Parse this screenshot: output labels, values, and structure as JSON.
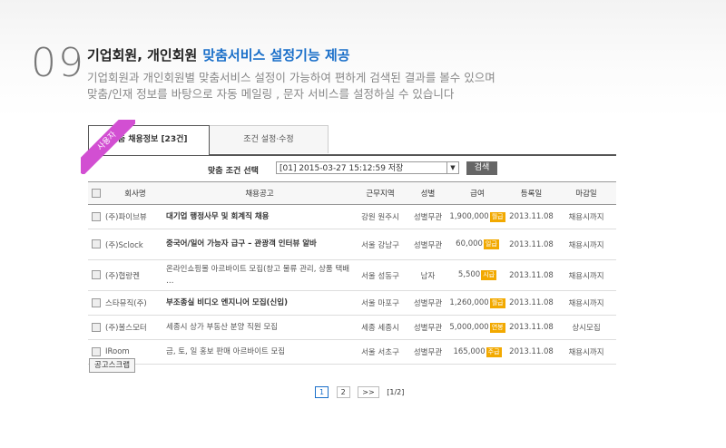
{
  "header": {
    "number": "09",
    "title": "기업회원, 개인회원",
    "title_highlight": "맞춤서비스 설정기능 제공",
    "desc1": "기업회원과 개인회원별 맞춤서비스 설정이 가능하여 편하게 검색된 결과를 볼수 있으며",
    "desc2": "맞춤/인재 정보를 바탕으로 자동 메일링 , 문자 서비스를 설정하실 수 있습니다"
  },
  "ribbon": "사용자",
  "tabs": {
    "active": "맞춤 채용정보 [23건]",
    "other": "조건 설정·수정"
  },
  "search": {
    "label": "맞춤 조건 선택",
    "selected": "[01] 2015-03-27 15:12:59 저장",
    "button": "검색"
  },
  "table": {
    "headers": [
      "회사명",
      "채용공고",
      "근무지역",
      "성별",
      "급여",
      "등록일",
      "마감일"
    ],
    "rows": [
      {
        "company": "(주)파이브뷰",
        "title": "대기업 행정사무 및 회계직 채용",
        "bold": true,
        "area": "강원 원주시",
        "gender": "성별무관",
        "pay": "1,900,000",
        "unit": "월급",
        "date": "2013.11.08",
        "close": "채용시까지"
      },
      {
        "company": "(주)Sclock",
        "title": "중국어/일어 가능자 급구 – 관광객 인터뷰 알바",
        "bold": true,
        "area": "서울 강남구",
        "gender": "성별무관",
        "pay": "60,000",
        "unit": "일급",
        "date": "2013.11.08",
        "close": "채용시까지"
      },
      {
        "company": "(주)협랑켄",
        "title": "온라인쇼핑몰 아르바이트 모집(창고 물류 관리, 상품 택배 …",
        "bold": false,
        "area": "서울 성동구",
        "gender": "남자",
        "pay": "5,500",
        "unit": "시급",
        "date": "2013.11.08",
        "close": "채용시까지"
      },
      {
        "company": "스타뮤직(주)",
        "title": "부조종실 비디오 엔지니어 모집(신입)",
        "bold": true,
        "area": "서울 마포구",
        "gender": "성별무관",
        "pay": "1,260,000",
        "unit": "월급",
        "date": "2013.11.08",
        "close": "채용시까지"
      },
      {
        "company": "(주)볼스모터",
        "title": "세종시 상가 부동산 분양 직원 모집",
        "bold": false,
        "area": "세종 세종시",
        "gender": "성별무관",
        "pay": "5,000,000",
        "unit": "연봉",
        "date": "2013.11.08",
        "close": "상시모집"
      },
      {
        "company": "IRoom",
        "title": "금, 토, 일 홍보 판매 아르바이트 모집",
        "bold": false,
        "area": "서울 서초구",
        "gender": "성별무관",
        "pay": "165,000",
        "unit": "주급",
        "date": "2013.11.08",
        "close": "채용시까지"
      }
    ]
  },
  "scrap_button": "공고스크랩",
  "pager": {
    "p1": "1",
    "p2": "2",
    "next": ">>",
    "info": "[1/2]"
  }
}
